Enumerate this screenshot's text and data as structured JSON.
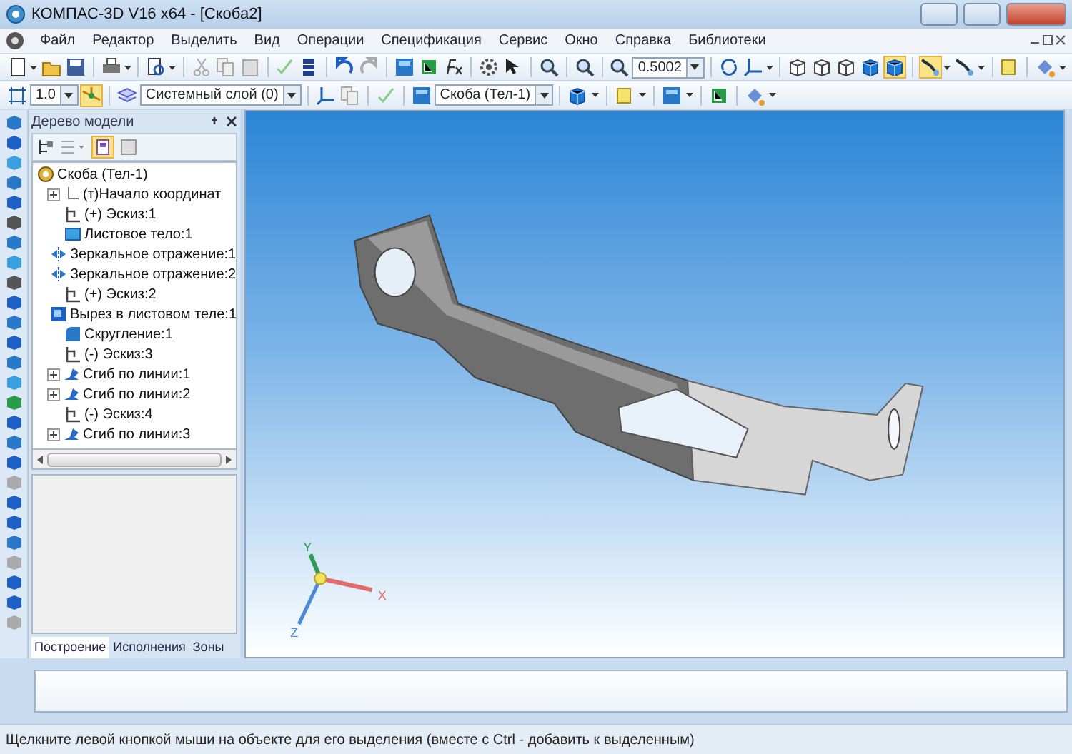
{
  "window": {
    "title": "КОМПАС-3D V16  x64 - [Скоба2]"
  },
  "menu": [
    "Файл",
    "Редактор",
    "Выделить",
    "Вид",
    "Операции",
    "Спецификация",
    "Сервис",
    "Окно",
    "Справка",
    "Библиотеки"
  ],
  "toolbar_1": [
    {
      "kind": "doc",
      "pressed": false
    },
    {
      "kind": "caret"
    },
    {
      "kind": "folder",
      "pressed": false
    },
    {
      "kind": "disk",
      "pressed": false
    },
    {
      "kind": "sep"
    },
    {
      "kind": "printer",
      "pressed": false
    },
    {
      "kind": "caret"
    },
    {
      "kind": "sep"
    },
    {
      "kind": "preview",
      "pressed": false
    },
    {
      "kind": "caret"
    },
    {
      "kind": "sep"
    },
    {
      "kind": "scissors",
      "pressed": false
    },
    {
      "kind": "copy",
      "pressed": false
    },
    {
      "kind": "paste",
      "pressed": false
    },
    {
      "kind": "sep"
    },
    {
      "kind": "check",
      "pressed": false
    },
    {
      "kind": "table",
      "pressed": false
    },
    {
      "kind": "sep"
    },
    {
      "kind": "undo",
      "pressed": false
    },
    {
      "kind": "redo",
      "pressed": false
    },
    {
      "kind": "sep"
    },
    {
      "kind": "manager",
      "pressed": false
    },
    {
      "kind": "tree",
      "pressed": false
    },
    {
      "kind": "fx",
      "pressed": false
    },
    {
      "kind": "sep"
    },
    {
      "kind": "gear",
      "pressed": false
    },
    {
      "kind": "help",
      "pressed": false
    },
    {
      "kind": "sep"
    },
    {
      "kind": "zoom",
      "pressed": false
    },
    {
      "kind": "sep"
    },
    {
      "kind": "zoom",
      "pressed": false
    },
    {
      "kind": "sep"
    },
    {
      "kind": "zoom",
      "pressed": false
    },
    {
      "kind": "combo",
      "value": "0.5002"
    },
    {
      "kind": "sep"
    },
    {
      "kind": "rotate",
      "pressed": false
    },
    {
      "kind": "axes",
      "pressed": false
    },
    {
      "kind": "caret"
    },
    {
      "kind": "sep"
    },
    {
      "kind": "cube",
      "pressed": false
    },
    {
      "kind": "cube",
      "pressed": false
    },
    {
      "kind": "cube",
      "pressed": false
    },
    {
      "kind": "cubeblue",
      "pressed": false
    },
    {
      "kind": "cubeblue",
      "pressed": true
    },
    {
      "kind": "sep"
    },
    {
      "kind": "filter",
      "pressed": true
    },
    {
      "kind": "caret"
    },
    {
      "kind": "filter",
      "pressed": false
    },
    {
      "kind": "caret"
    },
    {
      "kind": "sep"
    },
    {
      "kind": "sheet",
      "pressed": false
    },
    {
      "kind": "sep"
    },
    {
      "kind": "paint",
      "pressed": false
    },
    {
      "kind": "caret"
    }
  ],
  "toolbar_2": [
    {
      "kind": "grid",
      "pressed": false
    },
    {
      "kind": "combo",
      "value": "1.0"
    },
    {
      "kind": "snap",
      "pressed": true
    },
    {
      "kind": "sep"
    },
    {
      "kind": "layers",
      "pressed": false
    },
    {
      "kind": "combo",
      "value": "Системный слой (0)"
    },
    {
      "kind": "sep"
    },
    {
      "kind": "axes",
      "pressed": false
    },
    {
      "kind": "copy",
      "pressed": false
    },
    {
      "kind": "sep"
    },
    {
      "kind": "check",
      "pressed": false
    },
    {
      "kind": "sep"
    },
    {
      "kind": "manager",
      "pressed": false
    },
    {
      "kind": "combo",
      "value": "Скоба (Тел-1)"
    },
    {
      "kind": "sep"
    },
    {
      "kind": "cubeblue",
      "pressed": false
    },
    {
      "kind": "caret"
    },
    {
      "kind": "sep"
    },
    {
      "kind": "sheet",
      "pressed": false
    },
    {
      "kind": "caret"
    },
    {
      "kind": "sep"
    },
    {
      "kind": "manager",
      "pressed": false
    },
    {
      "kind": "caret"
    },
    {
      "kind": "sep"
    },
    {
      "kind": "tree",
      "pressed": false
    },
    {
      "kind": "sep"
    },
    {
      "kind": "paint",
      "pressed": false
    },
    {
      "kind": "caret"
    }
  ],
  "tree_panel": {
    "title": "Дерево модели",
    "root": {
      "label": "Скоба (Тел-1)",
      "kind": "part",
      "children": [
        {
          "label": "(т)Начало координат",
          "kind": "origin",
          "collapsed": true
        },
        {
          "label": "(+) Эскиз:1",
          "kind": "sketch",
          "collapsed": false
        },
        {
          "label": "Листовое тело:1",
          "kind": "sheet",
          "collapsed": false
        },
        {
          "label": "Зеркальное отражение:1",
          "kind": "mirror",
          "collapsed": false
        },
        {
          "label": "Зеркальное отражение:2",
          "kind": "mirror",
          "collapsed": false
        },
        {
          "label": "(+) Эскиз:2",
          "kind": "sketch",
          "collapsed": false
        },
        {
          "label": "Вырез в листовом теле:1",
          "kind": "cut",
          "collapsed": false
        },
        {
          "label": "Скругление:1",
          "kind": "fillet",
          "collapsed": false
        },
        {
          "label": "(-) Эскиз:3",
          "kind": "sketch",
          "collapsed": false
        },
        {
          "label": "Сгиб по линии:1",
          "kind": "bend",
          "collapsed": true
        },
        {
          "label": "Сгиб по линии:2",
          "kind": "bend",
          "collapsed": true
        },
        {
          "label": "(-) Эскиз:4",
          "kind": "sketch",
          "collapsed": false
        },
        {
          "label": "Сгиб по линии:3",
          "kind": "bend",
          "collapsed": true
        }
      ]
    },
    "tabs": [
      {
        "label": "Построение",
        "selected": true
      },
      {
        "label": "Исполнения",
        "selected": false
      },
      {
        "label": "Зоны",
        "selected": false
      }
    ]
  },
  "viewport": {
    "axis_labels": {
      "x": "X",
      "y": "Y",
      "z": "Z"
    }
  },
  "status_bar": "Щелкните левой кнопкой мыши на объекте для его выделения (вместе с Ctrl - добавить к выделенным)"
}
